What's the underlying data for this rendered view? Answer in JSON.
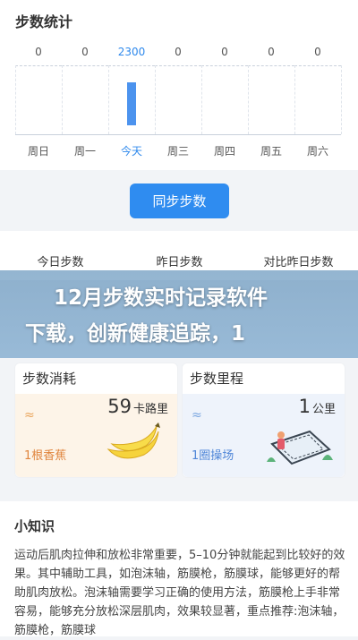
{
  "steps": {
    "title": "步数统计",
    "days": [
      {
        "label": "周日",
        "value": "0"
      },
      {
        "label": "周一",
        "value": "0"
      },
      {
        "label": "今天",
        "value": "2300"
      },
      {
        "label": "周三",
        "value": "0"
      },
      {
        "label": "周四",
        "value": "0"
      },
      {
        "label": "周五",
        "value": "0"
      },
      {
        "label": "周六",
        "value": "0"
      }
    ],
    "colors": {
      "accent": "#2f89ec",
      "bar": "#4c93ee"
    }
  },
  "sync_button": "同步步数",
  "summary": {
    "today": "今日步数",
    "yesterday": "昨日步数",
    "compare": "对比昨日步数"
  },
  "banner": {
    "line1": "12月步数实时记录软件",
    "line2": "下载，创新健康追踪，1"
  },
  "metrics": {
    "consumption": {
      "title": "步数消耗",
      "value": "59",
      "unit": "卡路里",
      "wave": "≈",
      "sub": "1根香蕉",
      "sub_color": "#e0853e",
      "bg": "#fdf4e8",
      "icon": "banana-icon"
    },
    "distance": {
      "title": "步数里程",
      "value": "1",
      "unit": "公里",
      "wave": "≈",
      "sub": "1圈操场",
      "sub_color": "#4f86d8",
      "bg": "#eef3fb",
      "icon": "track-icon"
    }
  },
  "knowledge": {
    "title": "小知识",
    "text": "运动后肌肉拉伸和放松非常重要，5–10分钟就能起到比较好的效果。其中辅助工具，如泡沫轴，筋膜枪，筋膜球，能够更好的帮助肌肉放松。泡沫轴需要学习正确的使用方法，筋膜枪上手非常容易，能够充分放松深层肌肉，效果较显著，重点推荐:泡沫轴，筋膜枪，筋膜球"
  }
}
